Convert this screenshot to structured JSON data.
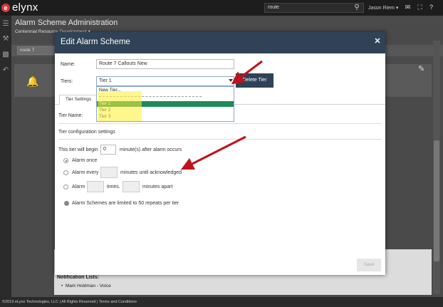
{
  "app": {
    "logo_mark": "e",
    "logo_text": "elynx",
    "search_value": "route",
    "user_menu": "Jason Riem ▾"
  },
  "page": {
    "title": "Alarm Scheme Administration",
    "subtitle": "Centennial Resource Development ▾",
    "search_value": "route 7",
    "notification_lists_label": "Notification Lists:",
    "notification_item": "Mark Holdman - Voice"
  },
  "footer": {
    "text": "©2019 eLynx Technologies, LLC | All Rights Reserved | Terms and Conditions"
  },
  "modal": {
    "title": "Edit Alarm Scheme",
    "name_label": "Name:",
    "name_value": "Route 7 Callouts New",
    "tiers_label": "Tiers:",
    "tiers_value": "Tier 1",
    "delete_tier_label": "Delete Tier",
    "tier_options": [
      "New Tier...",
      "Tier 1",
      "Tier 2",
      "Tier 3"
    ],
    "selected_option": "Tier 1",
    "tab_label": "Tier Settings",
    "tier_name_label": "Tier Name:",
    "config_title": "Tier configuration settings",
    "begin_prefix": "This tier will begin",
    "begin_value": "0",
    "begin_suffix": "minute(s) after alarm occurs",
    "alarm_once_label": "Alarm once",
    "alarm_every_label": "Alarm every",
    "alarm_every_suffix": "minutes until acknowledged",
    "alarm_label": "Alarm",
    "times_label": "times.",
    "minutes_apart_label": "minutes apart",
    "limit_note": "Alarm Schemes are limited to 50 repeats per tier",
    "save_label": "Save"
  },
  "colors": {
    "header": "#2f4256",
    "selected_option": "#1f8a5a",
    "annotation_arrow": "#c0121b",
    "highlight": "#fff032"
  }
}
